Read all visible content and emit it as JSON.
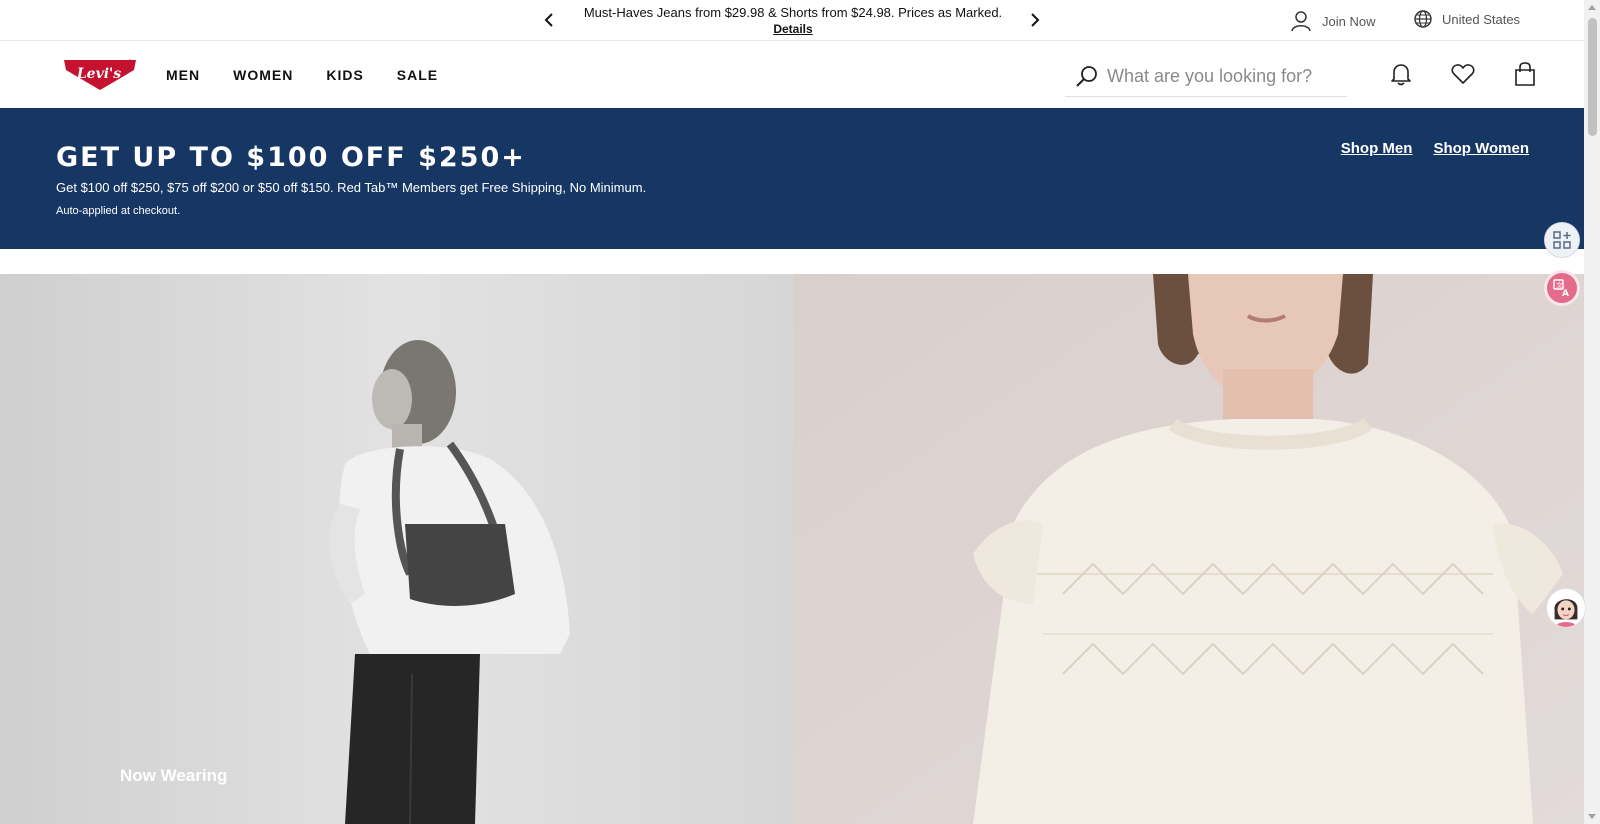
{
  "topbar": {
    "promo_text": "Must-Haves Jeans from $29.98 & Shorts from $24.98. Prices as Marked.",
    "promo_link": "Details",
    "join_label": "Join Now",
    "country_label": "United States"
  },
  "nav": {
    "logo_text": "Levi's",
    "links": [
      "MEN",
      "WOMEN",
      "KIDS",
      "SALE"
    ],
    "search_placeholder": "What are you looking for?"
  },
  "banner": {
    "title": "GET UP TO $100 OFF $250+",
    "subtitle": "Get $100 off $250, $75 off $200 or $50 off $150. Red Tab™ Members get Free Shipping, No Minimum.",
    "note": "Auto-applied at checkout.",
    "link_men": "Shop Men",
    "link_women": "Shop Women",
    "background_color": "#163764"
  },
  "hero": {
    "left_caption": "Now Wearing"
  },
  "colors": {
    "brand_red": "#c41230",
    "banner_navy": "#163764"
  }
}
